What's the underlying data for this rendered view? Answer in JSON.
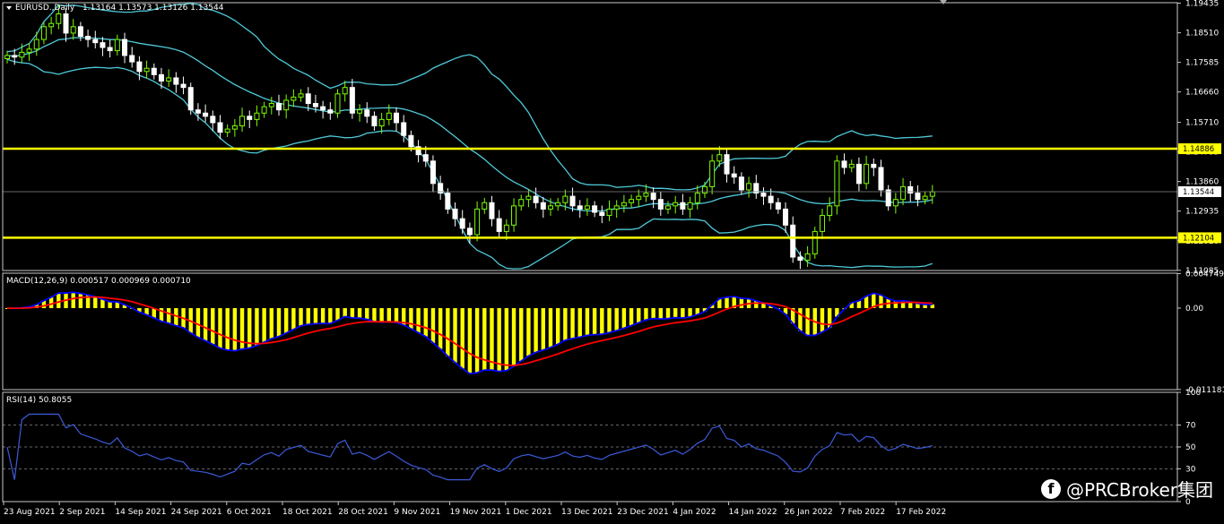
{
  "header": {
    "symbol_label": "EURUSD.,Daily",
    "ohlc": "1.13164 1.13573 1.13126 1.13544"
  },
  "macd_label": "MACD(12,26,9) 0.000517 0.000969 0.000710",
  "rsi_label": "RSI(14) 50.8055",
  "watermark": "@PRCBroker集团",
  "colors": {
    "background": "#000000",
    "grid": "#2a2a2a",
    "frame": "#c8c8c8",
    "bull": "#7CFC00",
    "bear": "#ffffff",
    "bollinger": "#4ec9d8",
    "hline": "#ffff00",
    "macd_hist": "#ffff00",
    "macd_main": "#0000ff",
    "macd_signal": "#ff0000",
    "rsi": "#3b5bdb"
  },
  "price_axis": {
    "ylim": [
      1.1108,
      1.1945
    ],
    "ticks": [
      "1.19435",
      "1.18510",
      "1.17585",
      "1.16660",
      "1.15710",
      "1.14785",
      "1.13860",
      "1.12935",
      "1.12010",
      "1.11085"
    ]
  },
  "macd_axis": {
    "ylim": [
      -0.0112,
      0.0048
    ],
    "ticks": [
      "0.004749",
      "0.00",
      "-0.011181"
    ]
  },
  "rsi_axis": {
    "ylim": [
      0,
      100
    ],
    "ticks": [
      "100",
      "70",
      "50",
      "30",
      "0"
    ],
    "levels": [
      70,
      50,
      30
    ]
  },
  "price_tags": [
    {
      "value": 1.14886,
      "text": "1.14886",
      "bg": "#ffff00"
    },
    {
      "value": 1.13544,
      "text": "1.13544",
      "bg": "#ffffff"
    },
    {
      "value": 1.12104,
      "text": "1.12104",
      "bg": "#ffff00"
    }
  ],
  "chart_data": {
    "type": "candlestick",
    "symbol": "EURUSD.",
    "timeframe": "Daily",
    "ohlc": {
      "open": 1.13164,
      "high": 1.13573,
      "low": 1.13126,
      "close": 1.13544
    },
    "x_labels": [
      "23 Aug 2021",
      "2 Sep 2021",
      "14 Sep 2021",
      "24 Sep 2021",
      "6 Oct 2021",
      "18 Oct 2021",
      "28 Oct 2021",
      "9 Nov 2021",
      "19 Nov 2021",
      "1 Dec 2021",
      "13 Dec 2021",
      "23 Dec 2021",
      "4 Jan 2022",
      "14 Jan 2022",
      "26 Jan 2022",
      "7 Feb 2022",
      "17 Feb 2022"
    ],
    "horizontal_lines": [
      1.14886,
      1.12104
    ],
    "close_series": [
      1.178,
      1.1775,
      1.179,
      1.18,
      1.183,
      1.187,
      1.188,
      1.191,
      1.185,
      1.187,
      1.184,
      1.183,
      1.182,
      1.1805,
      1.1795,
      1.183,
      1.178,
      1.176,
      1.173,
      1.174,
      1.172,
      1.17,
      1.171,
      1.169,
      1.168,
      1.161,
      1.16,
      1.159,
      1.157,
      1.154,
      1.155,
      1.156,
      1.159,
      1.158,
      1.16,
      1.162,
      1.163,
      1.161,
      1.164,
      1.165,
      1.166,
      1.163,
      1.162,
      1.161,
      1.16,
      1.166,
      1.168,
      1.16,
      1.161,
      1.159,
      1.156,
      1.158,
      1.16,
      1.157,
      1.153,
      1.1495,
      1.147,
      1.145,
      1.138,
      1.135,
      1.13,
      1.127,
      1.124,
      1.122,
      1.13,
      1.132,
      1.127,
      1.123,
      1.125,
      1.131,
      1.133,
      1.134,
      1.132,
      1.13,
      1.131,
      1.132,
      1.134,
      1.131,
      1.13,
      1.131,
      1.129,
      1.128,
      1.13,
      1.131,
      1.132,
      1.133,
      1.134,
      1.135,
      1.133,
      1.13,
      1.131,
      1.132,
      1.13,
      1.132,
      1.135,
      1.137,
      1.145,
      1.147,
      1.141,
      1.14,
      1.136,
      1.138,
      1.135,
      1.134,
      1.132,
      1.13,
      1.125,
      1.115,
      1.114,
      1.116,
      1.123,
      1.128,
      1.131,
      1.145,
      1.143,
      1.144,
      1.138,
      1.144,
      1.143,
      1.136,
      1.131,
      1.133,
      1.137,
      1.135,
      1.133,
      1.134,
      1.1354
    ],
    "bollinger_period": 20,
    "macd": {
      "fast": 12,
      "slow": 26,
      "signal": 9,
      "values": [
        0.000517,
        0.000969,
        0.00071
      ]
    },
    "rsi": {
      "period": 14,
      "value": 50.8055
    }
  }
}
